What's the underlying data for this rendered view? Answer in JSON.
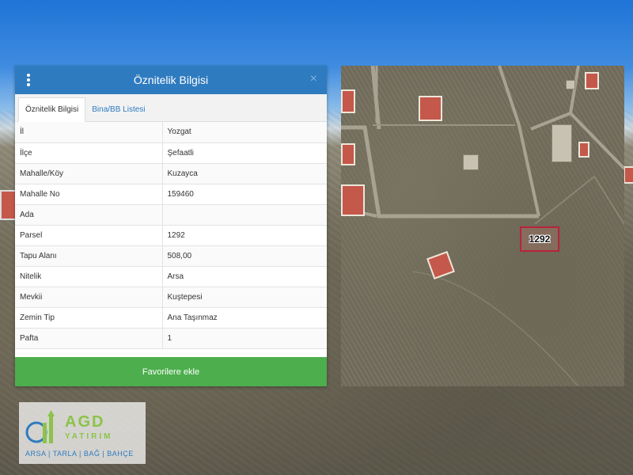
{
  "panel": {
    "title": "Öznitelik Bilgisi",
    "close_label": "×",
    "tabs": [
      {
        "label": "Öznitelik Bilgisi",
        "active": true
      },
      {
        "label": "Bina/BB Listesi",
        "active": false
      }
    ],
    "rows": [
      {
        "key": "İl",
        "value": "Yozgat"
      },
      {
        "key": "İlçe",
        "value": "Şefaatli"
      },
      {
        "key": "Mahalle/Köy",
        "value": "Kuzayca"
      },
      {
        "key": "Mahalle No",
        "value": "159460"
      },
      {
        "key": "Ada",
        "value": ""
      },
      {
        "key": "Parsel",
        "value": "1292"
      },
      {
        "key": "Tapu Alanı",
        "value": "508,00"
      },
      {
        "key": "Nitelik",
        "value": "Arsa"
      },
      {
        "key": "Mevkii",
        "value": "Kuştepesi"
      },
      {
        "key": "Zemin Tip",
        "value": "Ana Taşınmaz"
      },
      {
        "key": "Pafta",
        "value": "1"
      }
    ],
    "favorite_button": "Favorilere ekle"
  },
  "map": {
    "parcel_label": "1292"
  },
  "logo": {
    "title": "AGD",
    "subtitle": "YATIRIM",
    "tagline": "ARSA | TARLA | BAĞ | BAHÇE"
  },
  "colors": {
    "header": "#2f7bc0",
    "button": "#4cae4c",
    "parcel_border": "#b8233a",
    "logo_green": "#8bc34a",
    "logo_blue": "#2f7bc0"
  }
}
